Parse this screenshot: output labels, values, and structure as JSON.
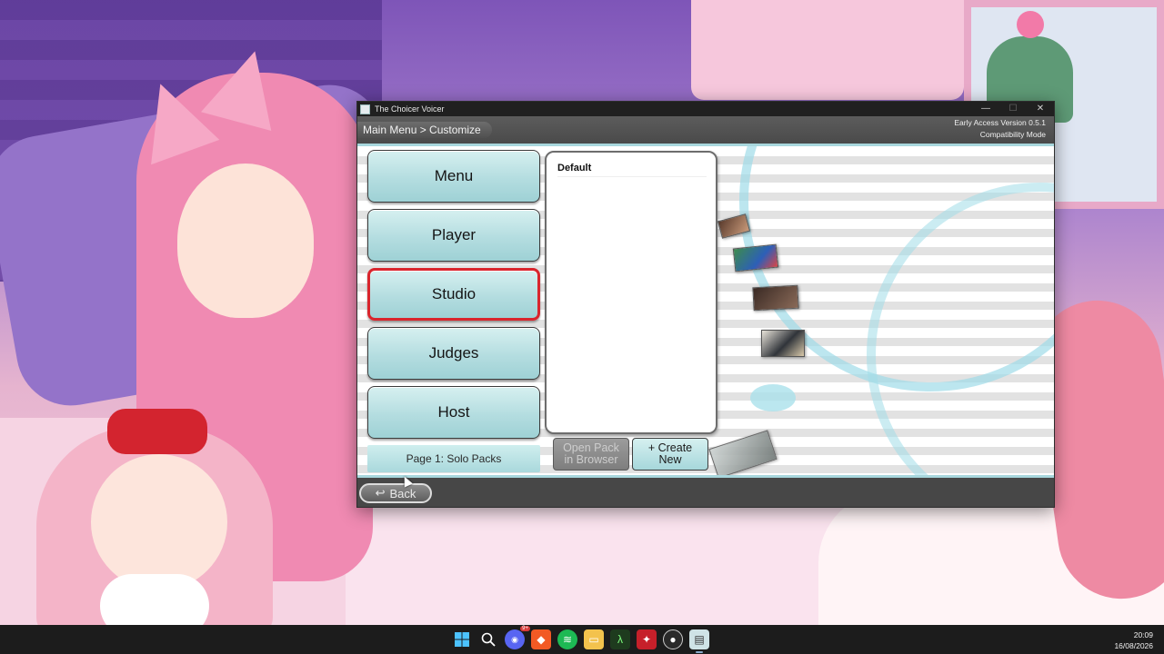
{
  "window": {
    "title": "The Choicer Voicer",
    "controls": {
      "minimize": "—",
      "maximize": "☐",
      "close": "✕"
    }
  },
  "header": {
    "breadcrumb": "Main Menu > Customize",
    "version": "Early Access Version 0.5.1",
    "mode": "Compatibility Mode"
  },
  "nav": {
    "items": [
      {
        "label": "Menu",
        "selected": false
      },
      {
        "label": "Player",
        "selected": false
      },
      {
        "label": "Studio",
        "selected": true
      },
      {
        "label": "Judges",
        "selected": false
      },
      {
        "label": "Host",
        "selected": false
      }
    ],
    "page_label": "Page 1: Solo Packs"
  },
  "pack_list": {
    "items": [
      "Default"
    ]
  },
  "actions": {
    "open_pack_line1": "Open Pack",
    "open_pack_line2": "in Browser",
    "create_new_line1": "+ Create",
    "create_new_line2": "New"
  },
  "footer": {
    "back_label": "Back",
    "back_icon": "return-arrow-icon"
  },
  "taskbar": {
    "icons": [
      "windows-start-icon",
      "search-icon",
      "discord-icon",
      "brave-icon",
      "spotify-icon",
      "file-explorer-icon",
      "terminal-icon",
      "game-icon",
      "obs-icon",
      "choicer-voicer-icon"
    ],
    "discord_badge": "9+",
    "time": "20:09",
    "date": "16/08/2026"
  },
  "colors": {
    "selected_border": "#d9252d",
    "button_teal": "#b4dde0",
    "chrome_gray": "#474747"
  }
}
